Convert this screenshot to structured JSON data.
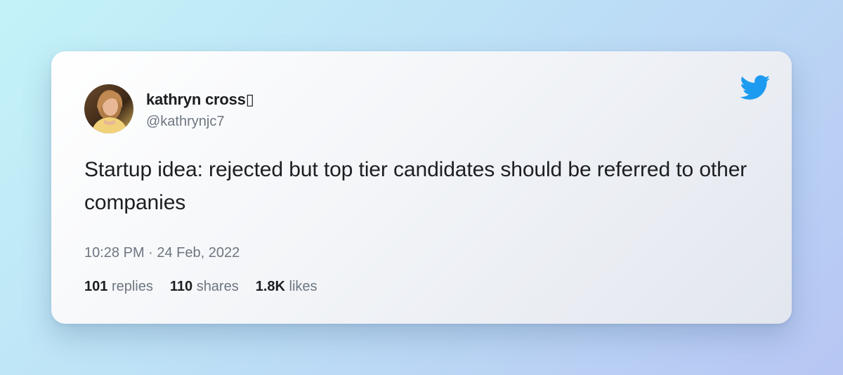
{
  "tweet": {
    "author": {
      "display_name": "kathryn cross▯",
      "handle": "@kathrynjc7",
      "avatar": "profile-photo"
    },
    "text": "Startup idea: rejected but top tier candidates should be referred to other companies",
    "timestamp": "10:28 PM · 24 Feb, 2022",
    "stats": {
      "replies": {
        "value": "101",
        "label": "replies"
      },
      "shares": {
        "value": "110",
        "label": "shares"
      },
      "likes": {
        "value": "1.8K",
        "label": "likes"
      }
    },
    "brand_icon": "twitter-bird-icon"
  },
  "colors": {
    "twitter_blue": "#1d9bf0",
    "text_primary": "#1c1e21",
    "text_secondary": "#6e7681"
  }
}
